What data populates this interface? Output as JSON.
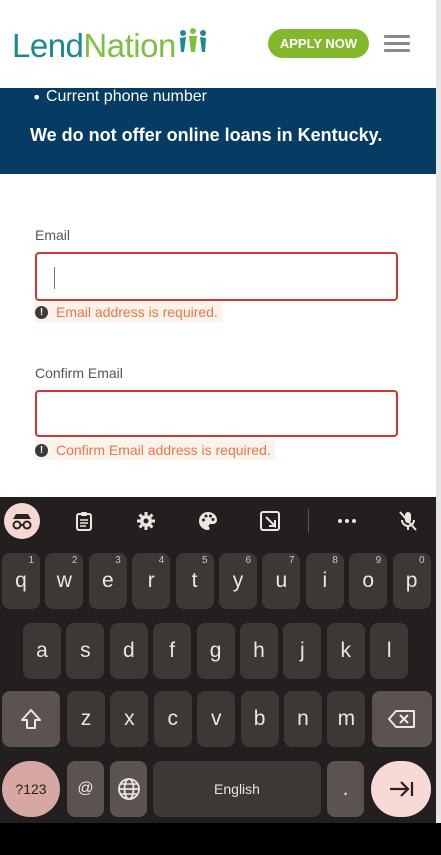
{
  "header": {
    "logo_lend": "Lend",
    "logo_nation": "Nation",
    "apply_label": "APPLY NOW"
  },
  "banner": {
    "bullet": "Current phone number",
    "note": "We do not offer online loans in Kentucky."
  },
  "form": {
    "email": {
      "label": "Email",
      "value": "",
      "error": "Email address is required."
    },
    "confirm_email": {
      "label": "Confirm Email",
      "value": "",
      "error": "Confirm Email address is required."
    },
    "error_icon_glyph": "!"
  },
  "keyboard": {
    "toolbar_icons": [
      "incognito-icon",
      "clipboard-icon",
      "settings-icon",
      "palette-icon",
      "resize-icon",
      "more-icon",
      "mic-off-icon"
    ],
    "row1": [
      {
        "key": "q",
        "hint": "1"
      },
      {
        "key": "w",
        "hint": "2"
      },
      {
        "key": "e",
        "hint": "3"
      },
      {
        "key": "r",
        "hint": "4"
      },
      {
        "key": "t",
        "hint": "5"
      },
      {
        "key": "y",
        "hint": "6"
      },
      {
        "key": "u",
        "hint": "7"
      },
      {
        "key": "i",
        "hint": "8"
      },
      {
        "key": "o",
        "hint": "9"
      },
      {
        "key": "p",
        "hint": "0"
      }
    ],
    "row2": [
      "a",
      "s",
      "d",
      "f",
      "g",
      "h",
      "j",
      "k",
      "l"
    ],
    "row3": [
      "z",
      "x",
      "c",
      "v",
      "b",
      "n",
      "m"
    ],
    "symbols_label": "?123",
    "at_label": "@",
    "space_label": "English",
    "period_label": "."
  },
  "colors": {
    "brand_teal": "#1b8a8e",
    "brand_green": "#83b82c",
    "banner_bg": "#063b63",
    "error_border": "#d0372e",
    "error_text": "#e8774a"
  }
}
